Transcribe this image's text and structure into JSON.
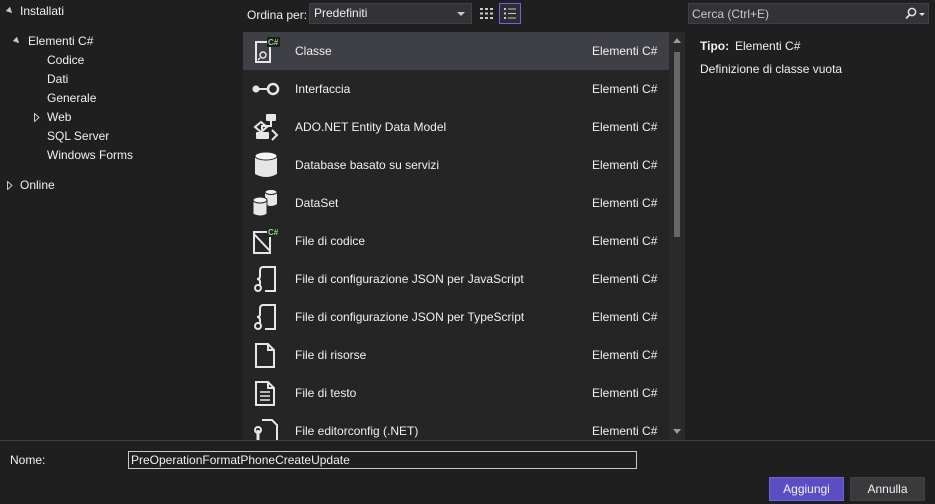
{
  "tree": {
    "installed": "Installati",
    "csharp_items": "Elementi C#",
    "children": [
      "Codice",
      "Dati",
      "Generale",
      "Web",
      "SQL Server",
      "Windows Forms"
    ],
    "online": "Online"
  },
  "toolbar": {
    "sort_label": "Ordina per:",
    "sort_value": "Predefiniti"
  },
  "search": {
    "placeholder": "Cerca (Ctrl+E)"
  },
  "items": [
    {
      "name": "Classe",
      "category": "Elementi C#",
      "icon": "class-file-icon",
      "selected": true
    },
    {
      "name": "Interfaccia",
      "category": "Elementi C#",
      "icon": "interface-icon"
    },
    {
      "name": "ADO.NET Entity Data Model",
      "category": "Elementi C#",
      "icon": "entity-model-icon"
    },
    {
      "name": "Database basato su servizi",
      "category": "Elementi C#",
      "icon": "database-icon"
    },
    {
      "name": "DataSet",
      "category": "Elementi C#",
      "icon": "dataset-icon"
    },
    {
      "name": "File di codice",
      "category": "Elementi C#",
      "icon": "code-file-icon"
    },
    {
      "name": "File di configurazione JSON per JavaScript",
      "category": "Elementi C#",
      "icon": "json-config-icon"
    },
    {
      "name": "File di configurazione JSON per TypeScript",
      "category": "Elementi C#",
      "icon": "json-config-icon"
    },
    {
      "name": "File di risorse",
      "category": "Elementi C#",
      "icon": "resource-file-icon"
    },
    {
      "name": "File di testo",
      "category": "Elementi C#",
      "icon": "text-file-icon"
    },
    {
      "name": "File editorconfig (.NET)",
      "category": "Elementi C#",
      "icon": "editorconfig-icon"
    }
  ],
  "details": {
    "type_label": "Tipo:",
    "type_value": "Elementi C#",
    "description": "Definizione di classe vuota"
  },
  "bottom": {
    "name_label": "Nome:",
    "name_value": "PreOperationFormatPhoneCreateUpdate",
    "add_label": "Aggiungi",
    "cancel_label": "Annulla"
  },
  "colors": {
    "accent": "#5b4ec4",
    "selected_row": "#3f3f46"
  }
}
